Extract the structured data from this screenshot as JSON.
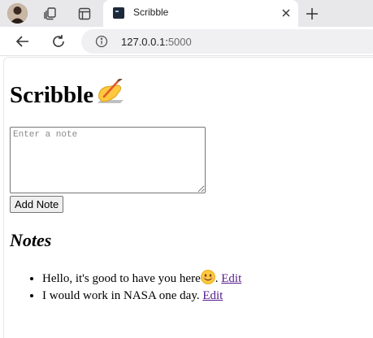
{
  "browser": {
    "tab_title": "Scribble",
    "url_host": "127.0.0.1:",
    "url_port": "5000"
  },
  "page": {
    "heading": "Scribble",
    "heading_emoji": "writing-hand-icon",
    "note_input_placeholder": "Enter a note",
    "add_button_label": "Add Note",
    "notes_heading": "Notes",
    "notes": [
      {
        "text": "Hello, it's good to have you here",
        "emoji": "smiling-face-icon",
        "suffix": ".",
        "edit_label": "Edit"
      },
      {
        "text": "I would work in NASA one day.",
        "emoji": "",
        "suffix": "",
        "edit_label": "Edit"
      }
    ]
  },
  "colors": {
    "link_visited": "#551a8b",
    "tabbar_bg": "#e8e8ea"
  }
}
